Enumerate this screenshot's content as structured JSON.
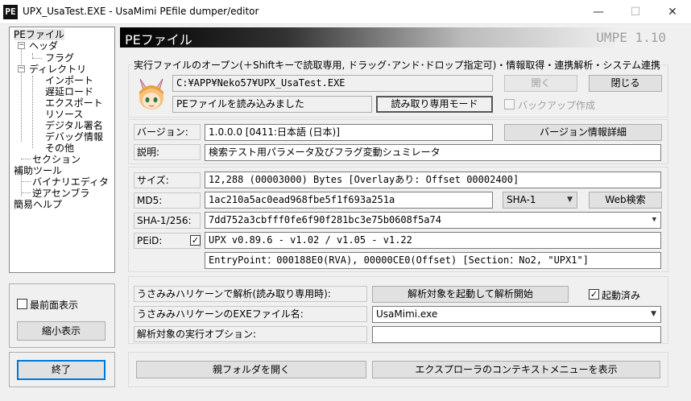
{
  "window": {
    "title": "UPX_UsaTest.EXE - UsaMimi PEfile dumper/editor",
    "app_icon": "PE",
    "minimize_glyph": "—",
    "maximize_glyph": "☐",
    "close_glyph": "✕"
  },
  "tree": {
    "root": "PEファイル",
    "header": "ヘッダ",
    "flags": "フラグ",
    "directory": "ディレクトリ",
    "import": "インポート",
    "delay_load": "遅延ロード",
    "export": "エクスポート",
    "resource": "リソース",
    "digital_signature": "デジタル署名",
    "debug_info": "デバッグ情報",
    "other": "その他",
    "section": "セクション",
    "tools": "補助ツール",
    "binary_editor": "バイナリエディタ",
    "disassembler": "逆アセンブラ",
    "help": "簡易ヘルプ",
    "expand_glyph": "−"
  },
  "left_panel": {
    "topmost_label": "最前面表示",
    "shrink_button": "縮小表示",
    "exit_button": "終了"
  },
  "banner": {
    "title": "PEファイル",
    "version": "UMPE 1.10"
  },
  "open_group": {
    "caption": "実行ファイルのオープン(＋Shiftキーで読取専用, ドラッグ･アンド･ドロップ指定可)・情報取得・連携解析・システム連携",
    "file_path": "C:¥APP¥Neko57¥UPX_UsaTest.EXE",
    "status_message": "PEファイルを読み込みました",
    "mode": "読み取り専用モード",
    "open_button": "開く",
    "close_button": "閉じる",
    "backup_label": "バックアップ作成"
  },
  "version_group": {
    "version_label": "バージョン:",
    "version_value": "1.0.0.0   [0411:日本語 (日本)]",
    "version_detail_button": "バージョン情報詳細",
    "description_label": "説明:",
    "description_value": "検索テスト用パラメータ及びフラグ変動シュミレータ"
  },
  "hash_group": {
    "size_label": "サイズ:",
    "size_value": "12,288 (00003000) Bytes    [Overlayあり: Offset 00002400]",
    "md5_label": "MD5:",
    "md5_value": "1ac210a5ac0ead968fbe5f1f693a251a",
    "hash_algo": "SHA-1",
    "web_search_button": "Web検索",
    "sha_label": "SHA-1/256:",
    "sha_value": "7dd752a3cbfff0fe6f90f281bc3e75b0608f5a74",
    "peid_label": "PEiD:",
    "peid_checked": "✓",
    "peid_value": "UPX v0.89.6 - v1.02 / v1.05 - v1.22",
    "entry_value": "EntryPoint：000188E0(RVA), 00000CE0(Offset) [Section：No2, \"UPX1\"]"
  },
  "hurricane_group": {
    "analyze_label": "うさみみハリケーンで解析(読み取り専用時):",
    "analyze_button": "解析対象を起動して解析開始",
    "launched_checked": "✓",
    "launched_label": "起動済み",
    "exe_label": "うさみみハリケーンのEXEファイル名:",
    "exe_value": "UsaMimi.exe",
    "options_label": "解析対象の実行オプション:",
    "options_value": ""
  },
  "bottom_buttons": {
    "open_parent_folder": "親フォルダを開く",
    "show_context_menu": "エクスプローラのコンテキストメニューを表示"
  }
}
